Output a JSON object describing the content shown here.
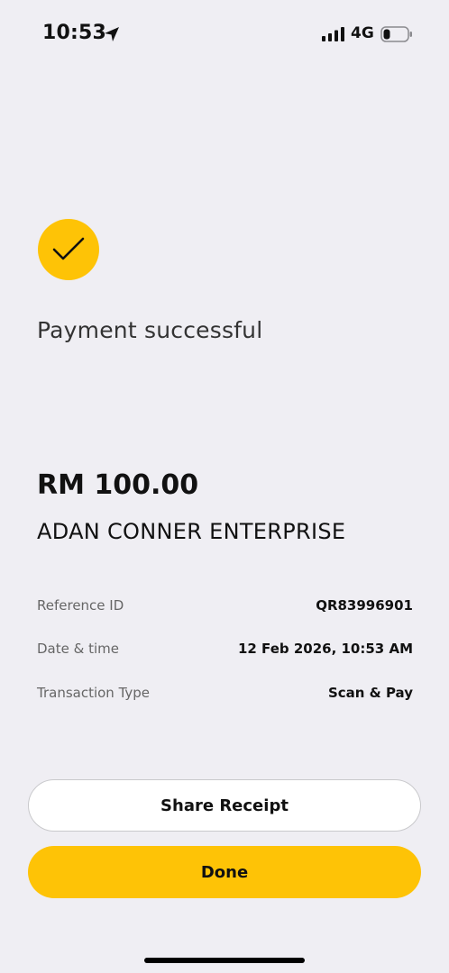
{
  "status_bar": {
    "time": "10:53",
    "network": "4G",
    "icons": [
      "location-arrow-icon",
      "signal-bars-icon",
      "battery-icon"
    ]
  },
  "result": {
    "icon": "checkmark-icon",
    "title": "Payment successful"
  },
  "payment": {
    "amount": "RM 100.00",
    "merchant": "ADAN CONNER ENTERPRISE"
  },
  "details": [
    {
      "label": "Reference ID",
      "value": "QR83996901"
    },
    {
      "label": "Date & time",
      "value": "12 Feb 2026, 10:53 AM"
    },
    {
      "label": "Transaction Type",
      "value": "Scan & Pay"
    }
  ],
  "actions": {
    "share_label": "Share Receipt",
    "done_label": "Done"
  },
  "colors": {
    "accent": "#fec306",
    "background": "#efeef3",
    "text": "#111111",
    "muted_text": "#666666"
  }
}
